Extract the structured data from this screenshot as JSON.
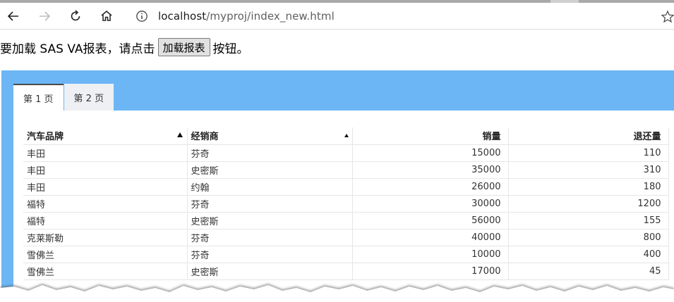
{
  "browser": {
    "url_host": "localhost",
    "url_path": "/myproj/index_new.html",
    "icons": [
      "back-arrow-icon",
      "forward-arrow-icon",
      "refresh-icon",
      "home-icon",
      "info-icon",
      "star-icon"
    ]
  },
  "page": {
    "intro_before": "要加载 SAS VA报表，请点击",
    "load_button": "加载报表",
    "intro_after": "按钮。"
  },
  "report": {
    "background": "#6cb6f5",
    "tabs": [
      {
        "label": "第 1 页",
        "active": true
      },
      {
        "label": "第 2 页",
        "active": false
      }
    ],
    "table": {
      "columns": [
        "汽车品牌",
        "经销商",
        "销量",
        "退还量"
      ],
      "rows": [
        [
          "丰田",
          "芬奇",
          "15000",
          "110"
        ],
        [
          "丰田",
          "史密斯",
          "35000",
          "310"
        ],
        [
          "丰田",
          "约翰",
          "26000",
          "180"
        ],
        [
          "福特",
          "芬奇",
          "30000",
          "1200"
        ],
        [
          "福特",
          "史密斯",
          "56000",
          "155"
        ],
        [
          "克莱斯勒",
          "芬奇",
          "40000",
          "800"
        ],
        [
          "雪佛兰",
          "芬奇",
          "10000",
          "400"
        ],
        [
          "雪佛兰",
          "史密斯",
          "17000",
          "45"
        ]
      ]
    }
  }
}
